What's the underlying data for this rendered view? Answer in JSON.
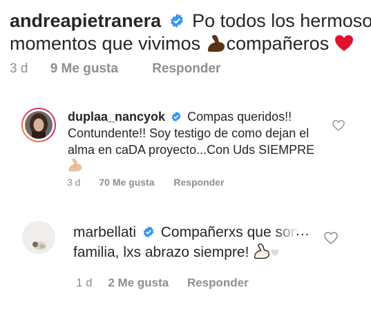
{
  "comments": [
    {
      "username": "andreapietranera",
      "text_line1": "Po todos los hermosos",
      "text_line2_pre": "momentos que vivimos ",
      "text_line2_post": "compañeros ",
      "emojis": [
        "flexed-biceps-dark",
        "red-heart"
      ],
      "time": "3 d",
      "likes": "9 Me gusta",
      "reply": "Responder"
    },
    {
      "username": "duplaa_nancyok",
      "text_line1": "Compas queridos!!",
      "text_line2": "Contundente!! Soy testigo de como dejan el",
      "text_line3": "alma en caDA proyecto...Con Uds SIEMPRE",
      "emojis": [
        "flexed-biceps-light"
      ],
      "time": "3 d",
      "likes": "70 Me gusta",
      "reply": "Responder"
    },
    {
      "username": "marbellati",
      "text_line1": "Compañerxs que son",
      "text_line2": "familia, lxs abrazo siempre! ",
      "emojis": [
        "flexed-biceps-outline",
        "white-heart"
      ],
      "more": "...",
      "time": "1 d",
      "likes": "2 Me gusta",
      "reply": "Responder"
    }
  ],
  "colors": {
    "text": "#262626",
    "meta": "#8e8e8e",
    "verified": "#3897f0",
    "story_ring_start": "#f9a12e",
    "story_ring_end": "#c13584"
  }
}
